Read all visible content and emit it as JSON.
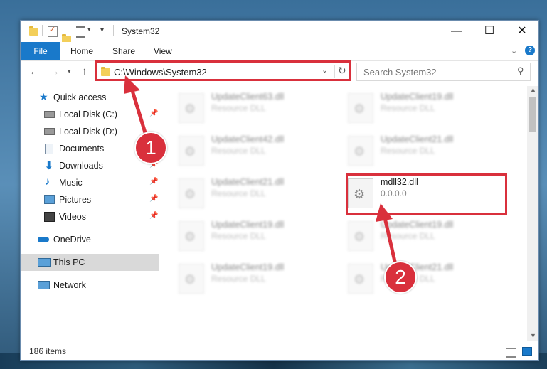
{
  "window": {
    "title": "System32"
  },
  "ribbon": {
    "tabs": [
      "File",
      "Home",
      "Share",
      "View"
    ]
  },
  "address": {
    "path": "C:\\Windows\\System32"
  },
  "search": {
    "placeholder": "Search System32"
  },
  "sidebar": {
    "items": [
      {
        "label": "Quick access",
        "icon": "star-icon"
      },
      {
        "label": "Local Disk (C:)",
        "icon": "drive-icon",
        "pinned": true
      },
      {
        "label": "Local Disk (D:)",
        "icon": "drive-icon",
        "pinned": false
      },
      {
        "label": "Documents",
        "icon": "documents-icon",
        "pinned": true
      },
      {
        "label": "Downloads",
        "icon": "download-icon",
        "pinned": true
      },
      {
        "label": "Music",
        "icon": "music-icon",
        "pinned": true
      },
      {
        "label": "Pictures",
        "icon": "pictures-icon",
        "pinned": true
      },
      {
        "label": "Videos",
        "icon": "videos-icon",
        "pinned": true
      },
      {
        "label": "OneDrive",
        "icon": "cloud-icon"
      },
      {
        "label": "This PC",
        "icon": "computer-icon",
        "selected": true
      },
      {
        "label": "Network",
        "icon": "network-icon"
      }
    ]
  },
  "files": [
    {
      "name": "UpdateClient63.dll",
      "desc": "Resource DLL",
      "blurred": true
    },
    {
      "name": "UpdateClient19.dll",
      "desc": "Resource DLL",
      "blurred": true
    },
    {
      "name": "UpdateClient42.dll",
      "desc": "Resource DLL",
      "blurred": true
    },
    {
      "name": "UpdateClient21.dll",
      "desc": "Resource DLL",
      "blurred": true
    },
    {
      "name": "UpdateClient21.dll",
      "desc": "Resource DLL",
      "blurred": true
    },
    {
      "name": "mdll32.dll",
      "desc": "0.0.0.0",
      "blurred": false
    },
    {
      "name": "UpdateClient19.dll",
      "desc": "Resource DLL",
      "blurred": true
    },
    {
      "name": "UpdateClient19.dll",
      "desc": "Resource DLL",
      "blurred": true
    },
    {
      "name": "UpdateClient19.dll",
      "desc": "Resource DLL",
      "blurred": true
    },
    {
      "name": "UpdateClient21.dll",
      "desc": "Resource DLL",
      "blurred": true
    }
  ],
  "status": {
    "item_count": "186 items"
  },
  "annotations": {
    "badge1": "1",
    "badge2": "2",
    "highlight_color": "#d9303c"
  },
  "colors": {
    "accent": "#1979ca"
  }
}
